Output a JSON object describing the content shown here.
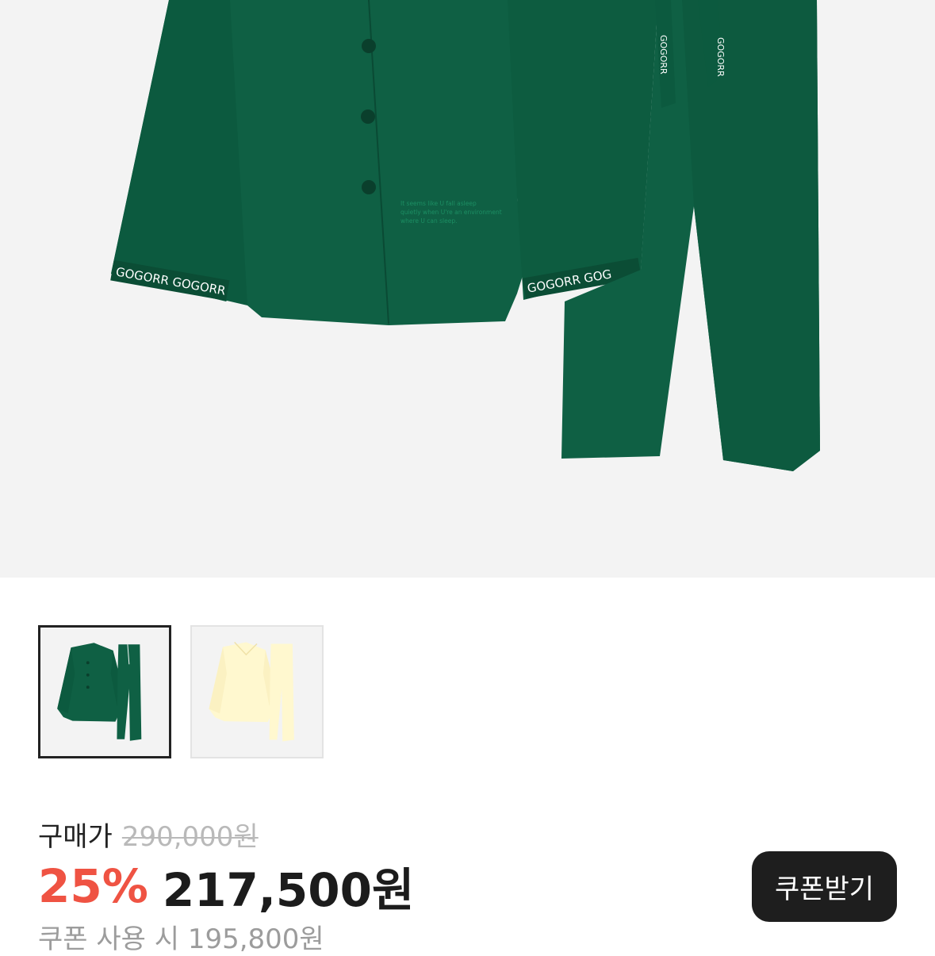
{
  "product": {
    "hero_image": {
      "alt": "green pajama set",
      "shirt_print_text": [
        "It seems like U fall asleep",
        "quietly when U're an environment",
        "where U can sleep."
      ],
      "cuff_logo": "GOGORR GOG",
      "cuff_logo_left": "GOGORR GOGORR",
      "tie_logo": "GOGORR"
    },
    "thumbnails": [
      {
        "color_name": "green",
        "selected": true
      },
      {
        "color_name": "cream",
        "selected": false
      }
    ]
  },
  "pricing": {
    "purchase_label": "구매가",
    "original_price": "290,000원",
    "discount_percent": "25%",
    "sale_price": "217,500원",
    "coupon_price_text": "쿠폰 사용 시 195,800원"
  },
  "coupon_button": {
    "label": "쿠폰받기"
  },
  "colors": {
    "hero_bg": "#f3f3f3",
    "pajama_green": "#0f6044",
    "pajama_cream": "#fff8cf",
    "discount_red": "#ef5343",
    "button_dark": "#1e1e1e"
  }
}
